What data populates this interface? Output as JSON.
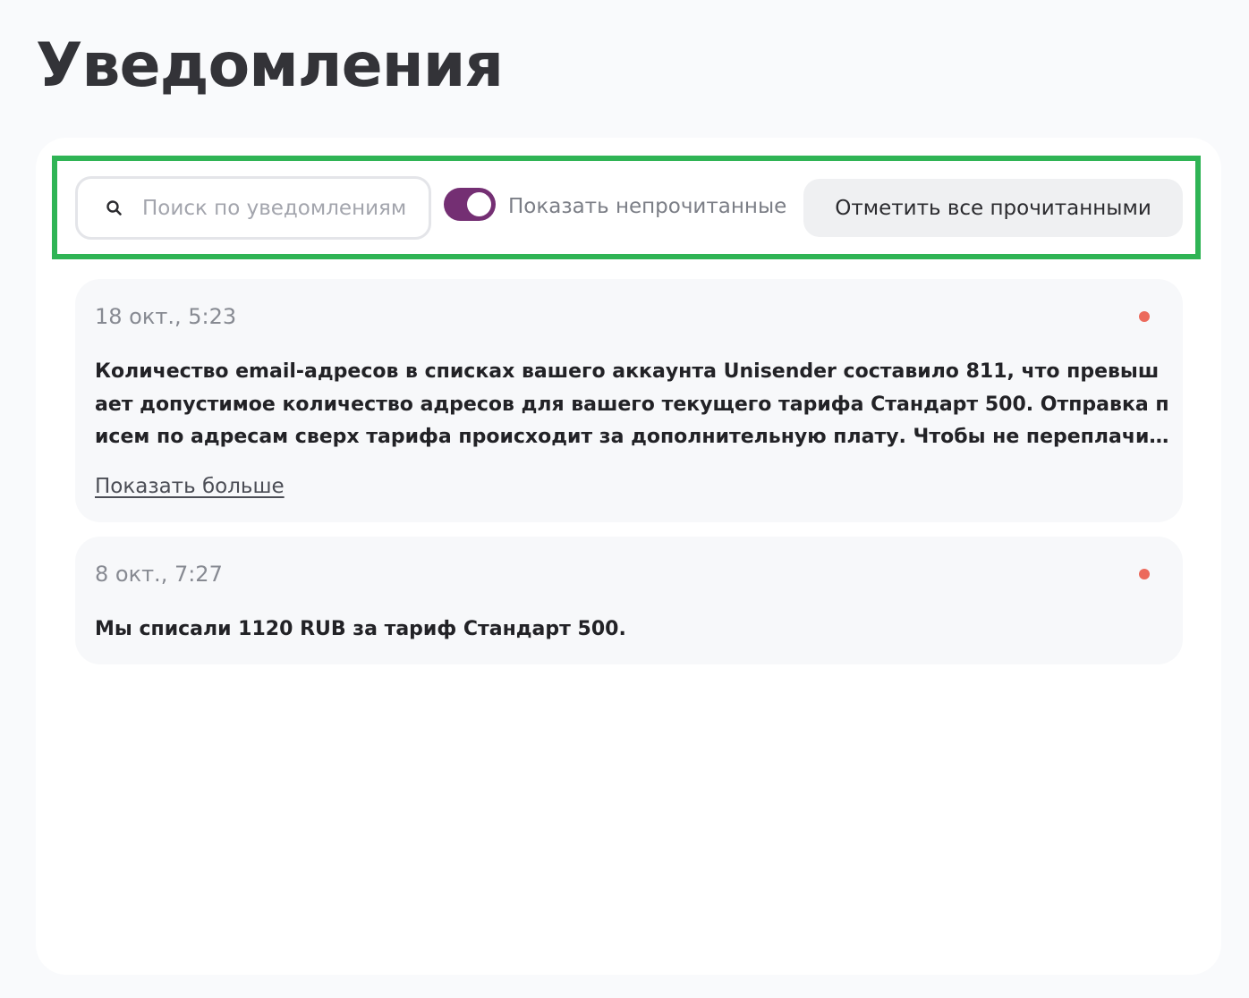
{
  "page": {
    "title": "Уведомления"
  },
  "toolbar": {
    "search_placeholder": "Поиск по уведомлениям",
    "toggle_label": "Показать непрочитанные",
    "toggle_on": true,
    "mark_all_label": "Отметить все прочитанными"
  },
  "notifications": [
    {
      "date": "18 окт., 5:23",
      "unread": true,
      "text": "Количество email-адресов в списках вашего аккаунта Unisender составило 811, что превышает допустимое количество адресов для вашего текущего тарифа Стандарт 500. Отправка писем по адресам сверх тарифа происходит за дополнительную плату. Чтобы не переплачив…",
      "more_label": "Показать больше"
    },
    {
      "date": "8 окт., 7:27",
      "unread": true,
      "text": "Мы списали 1120 RUB за тариф Стандарт 500."
    }
  ],
  "colors": {
    "accent": "#742f73",
    "unread_dot": "#ec6a5c",
    "highlight_frame": "#2fb455"
  }
}
